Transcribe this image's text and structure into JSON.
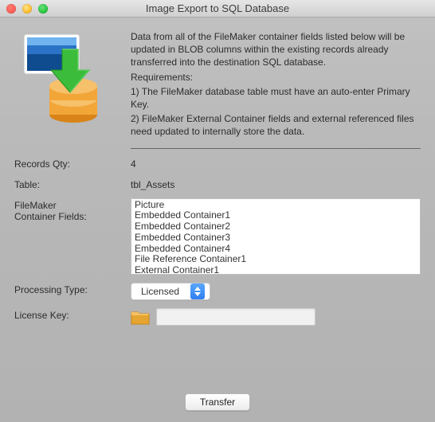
{
  "window": {
    "title": "Image Export to SQL Database"
  },
  "intro": {
    "p1": "Data from all of the FileMaker container fields listed below will be updated in BLOB columns within the existing records already transferred into the destination SQL database.",
    "req_label": "Requirements:",
    "req1": "1) The FileMaker database table must have an auto-enter Primary Key.",
    "req2": "2) FileMaker External Container fields and external referenced files need updated to internally store the data."
  },
  "labels": {
    "records_qty": "Records Qty:",
    "table": "Table:",
    "container_fields_l1": "FileMaker",
    "container_fields_l2": "Container Fields:",
    "processing_type": "Processing Type:",
    "license_key": "License Key:"
  },
  "values": {
    "records_qty": "4",
    "table": "tbl_Assets",
    "processing_type_selected": "Licensed",
    "license_key": ""
  },
  "container_fields": [
    "Picture",
    "Embedded Container1",
    "Embedded Container2",
    "Embedded Container3",
    "Embedded Container4",
    "File Reference Container1",
    "External Container1"
  ],
  "buttons": {
    "transfer": "Transfer"
  }
}
